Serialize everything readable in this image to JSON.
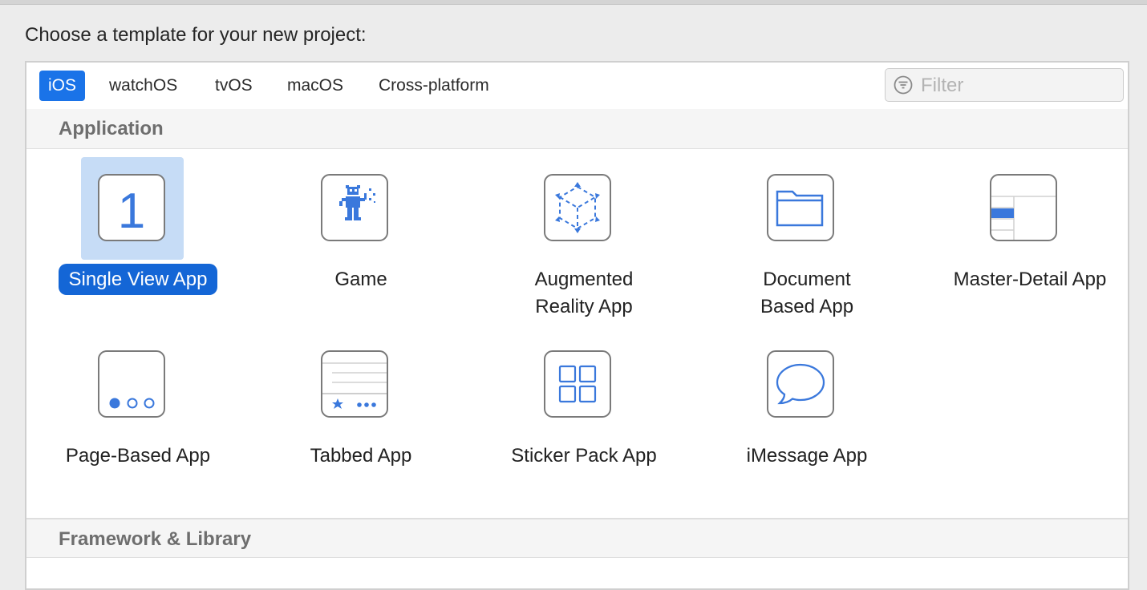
{
  "prompt": "Choose a template for your new project:",
  "platform_tabs": [
    "iOS",
    "watchOS",
    "tvOS",
    "macOS",
    "Cross-platform"
  ],
  "selected_tab": "iOS",
  "filter": {
    "placeholder": "Filter",
    "value": ""
  },
  "sections": {
    "application": "Application",
    "framework": "Framework & Library"
  },
  "templates": [
    {
      "label": "Single View App",
      "icon": "single-view-icon",
      "selected": true
    },
    {
      "label": "Game",
      "icon": "game-icon"
    },
    {
      "label": "Augmented Reality App",
      "icon": "ar-cube-icon"
    },
    {
      "label": "Document Based App",
      "icon": "folder-icon"
    },
    {
      "label": "Master-Detail App",
      "icon": "master-detail-icon"
    },
    {
      "label": "Page-Based App",
      "icon": "page-dots-icon"
    },
    {
      "label": "Tabbed App",
      "icon": "tab-bar-icon"
    },
    {
      "label": "Sticker Pack App",
      "icon": "sticker-grid-icon"
    },
    {
      "label": "iMessage App",
      "icon": "speech-bubble-icon"
    }
  ],
  "single_view_glyph": "1",
  "accent_color": "#1466d6",
  "icon_color": "#3a78dc"
}
